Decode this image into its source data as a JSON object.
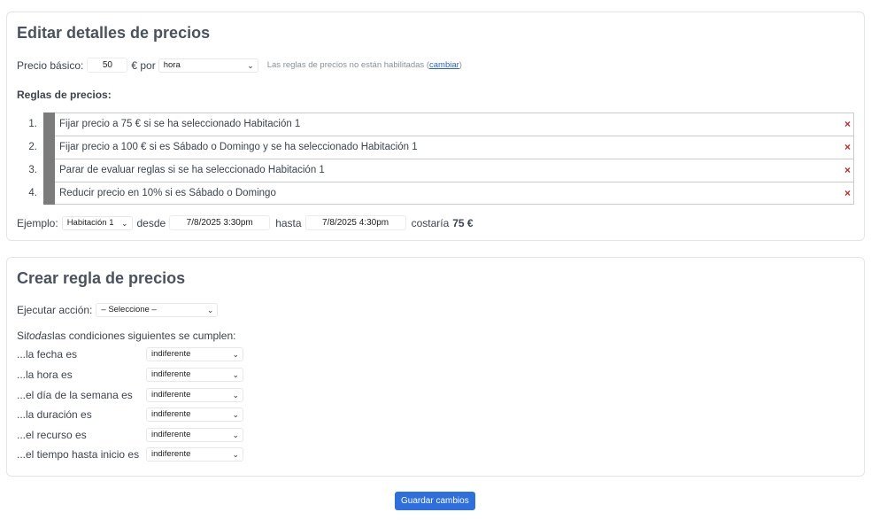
{
  "edit": {
    "title": "Editar detalles de precios",
    "base_label": "Precio básico:",
    "base_value": "50",
    "per_label": "€ por",
    "unit_selected": "hora",
    "rules_disabled_text": "Las reglas de precios no están habilitadas (",
    "change_link": "cambiar",
    "rules_disabled_close": ")",
    "rules_heading": "Reglas de precios:",
    "rules": [
      {
        "num": "1.",
        "text": "Fijar precio a 75 € si se ha seleccionado Habitación 1"
      },
      {
        "num": "2.",
        "text": "Fijar precio a 100 € si es Sábado o Domingo y se ha seleccionado Habitación 1"
      },
      {
        "num": "3.",
        "text": "Parar de evaluar reglas si se ha seleccionado Habitación 1"
      },
      {
        "num": "4.",
        "text": "Reducir precio en 10% si es Sábado o Domingo"
      }
    ],
    "delete_glyph": "×",
    "example": {
      "label": "Ejemplo:",
      "resource": "Habitación 1",
      "from_label": "desde",
      "from_value": "7/8/2025 3:30pm",
      "to_label": "hasta",
      "to_value": "7/8/2025 4:30pm",
      "cost_label": "costaría",
      "cost_value": "75 €"
    }
  },
  "create": {
    "title": "Crear regla de precios",
    "action_label": "Ejecutar acción:",
    "action_selected": "– Seleccione –",
    "cond_intro_pre": "Si ",
    "cond_intro_em": "todas",
    "cond_intro_post": " las condiciones siguientes se cumplen:",
    "conditions": [
      {
        "label": "...la fecha es",
        "value": "indiferente"
      },
      {
        "label": "...la hora es",
        "value": "indiferente"
      },
      {
        "label": "...el día de la semana es",
        "value": "indiferente"
      },
      {
        "label": "...la duración es",
        "value": "indiferente"
      },
      {
        "label": "...el recurso es",
        "value": "indiferente"
      },
      {
        "label": "...el tiempo hasta inicio es",
        "value": "indiferente"
      }
    ]
  },
  "save_label": "Guardar cambios",
  "icons": {
    "chevron": "chevron-down-icon",
    "delete": "close-icon"
  },
  "colors": {
    "accent": "#2e6fe0",
    "delete": "#c62828",
    "rule_bar": "#7b7b7b"
  }
}
